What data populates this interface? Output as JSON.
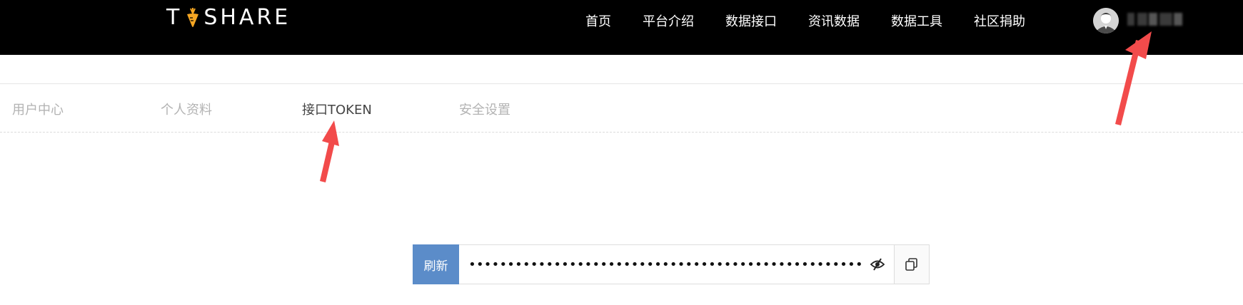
{
  "header": {
    "logo": {
      "left": "T",
      "right": "SHARE"
    },
    "nav": [
      "首页",
      "平台介绍",
      "数据接口",
      "资讯数据",
      "数据工具",
      "社区捐助"
    ],
    "user": {
      "avatar_icon": "user-avatar-icon"
    }
  },
  "subnav": {
    "items": [
      "用户中心",
      "个人资料",
      "接口TOKEN",
      "安全设置"
    ],
    "active_index": 2
  },
  "token": {
    "refresh_label": "刷新",
    "value": "************************************************************"
  },
  "colors": {
    "header_bg": "#000000",
    "accent_button": "#5b8cc9",
    "annotation_arrow": "#f24b4b",
    "logo_carrot": "#f5a623"
  }
}
